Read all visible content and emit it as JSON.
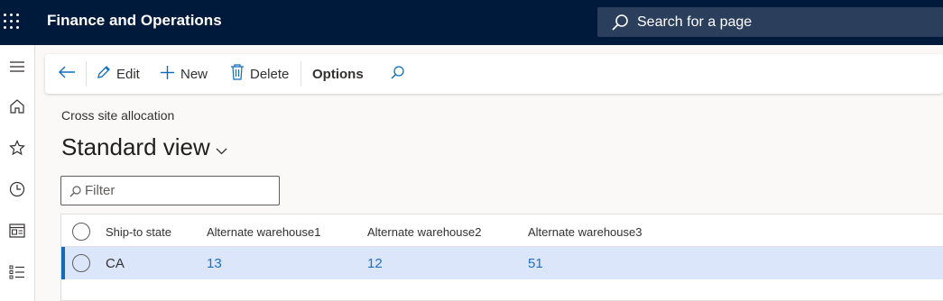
{
  "app": {
    "title": "Finance and Operations"
  },
  "search": {
    "label": "Search for a page"
  },
  "nav": {
    "items": [
      "menu-icon",
      "home-icon",
      "star-icon",
      "clock-icon",
      "workspace-icon",
      "list-icon"
    ]
  },
  "toolbar": {
    "back_icon": "back-arrow-icon",
    "edit_label": "Edit",
    "new_label": "New",
    "delete_label": "Delete",
    "options_label": "Options",
    "find_icon": "search-icon"
  },
  "page": {
    "caption": "Cross site allocation",
    "view_title": "Standard view"
  },
  "filter": {
    "placeholder": "Filter"
  },
  "grid": {
    "columns": [
      "Ship-to state",
      "Alternate warehouse1",
      "Alternate warehouse2",
      "Alternate warehouse3"
    ],
    "rows": [
      {
        "state": "CA",
        "wh1": "13",
        "wh2": "12",
        "wh3": "51"
      }
    ]
  },
  "colors": {
    "topbar": "#001a3b",
    "accent": "#0f6cbd",
    "selected_row": "#dce6fa",
    "link": "#1f6fc5"
  }
}
